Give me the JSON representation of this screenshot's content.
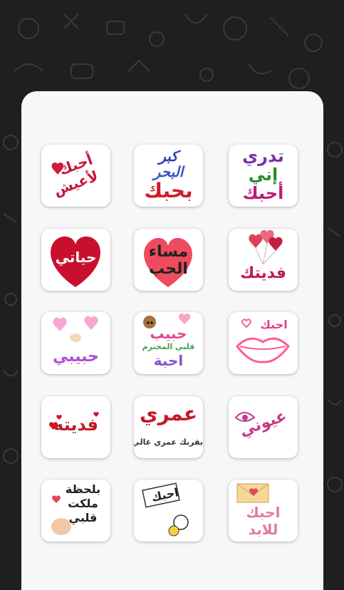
{
  "stickers": [
    {
      "id": "r1c1",
      "lines": [
        "تدري",
        "إني",
        "أحبك"
      ],
      "colors": [
        "#7a2ea8",
        "#2e8a2e",
        "#c0197a"
      ]
    },
    {
      "id": "r1c2",
      "lines": [
        "كبر",
        "البحر",
        "بحبك"
      ],
      "colors": [
        "#2a3fa8",
        "#3556c0",
        "#d11a2a"
      ]
    },
    {
      "id": "r1c3",
      "lines": [
        "أحبك",
        "لأعيش"
      ],
      "colors": [
        "#c8163a",
        "#c8163a"
      ]
    },
    {
      "id": "r2c1",
      "lines": [
        "فديتك"
      ],
      "colors": [
        "#c2185b"
      ]
    },
    {
      "id": "r2c2",
      "lines": [
        "مساء",
        "الحب"
      ],
      "colors": [
        "#222222",
        "#222222"
      ]
    },
    {
      "id": "r2c3",
      "lines": [
        "حياتي"
      ],
      "colors": [
        "#ffffff"
      ]
    },
    {
      "id": "r3c1",
      "lines": [
        "احبك"
      ],
      "colors": [
        "#e83d8c"
      ]
    },
    {
      "id": "r3c2",
      "lines": [
        "حبيب",
        "قلبي المحترم",
        "احبة"
      ],
      "colors": [
        "#e0478f",
        "#3fa34d",
        "#8a4fd0"
      ]
    },
    {
      "id": "r3c3",
      "lines": [
        "حبيبي"
      ],
      "colors": [
        "#b44bd8"
      ]
    },
    {
      "id": "r4c1",
      "lines": [
        "عيوني"
      ],
      "colors": [
        "#c23a86"
      ]
    },
    {
      "id": "r4c2",
      "lines": [
        "عمري",
        "بقربك عمري غالي"
      ],
      "colors": [
        "#c21a2a",
        "#333333"
      ]
    },
    {
      "id": "r4c3",
      "lines": [
        "فديته"
      ],
      "colors": [
        "#c21a2a"
      ]
    },
    {
      "id": "r5c1",
      "lines": [
        "احبك",
        "للابد"
      ],
      "colors": [
        "#e07aa0",
        "#e07aa0"
      ]
    },
    {
      "id": "r5c2",
      "lines": [
        "احبك"
      ],
      "colors": [
        "#222222"
      ]
    },
    {
      "id": "r5c3",
      "lines": [
        "بلحظة",
        "ملكت",
        "قلبي"
      ],
      "colors": [
        "#222222",
        "#222222",
        "#222222"
      ]
    }
  ]
}
